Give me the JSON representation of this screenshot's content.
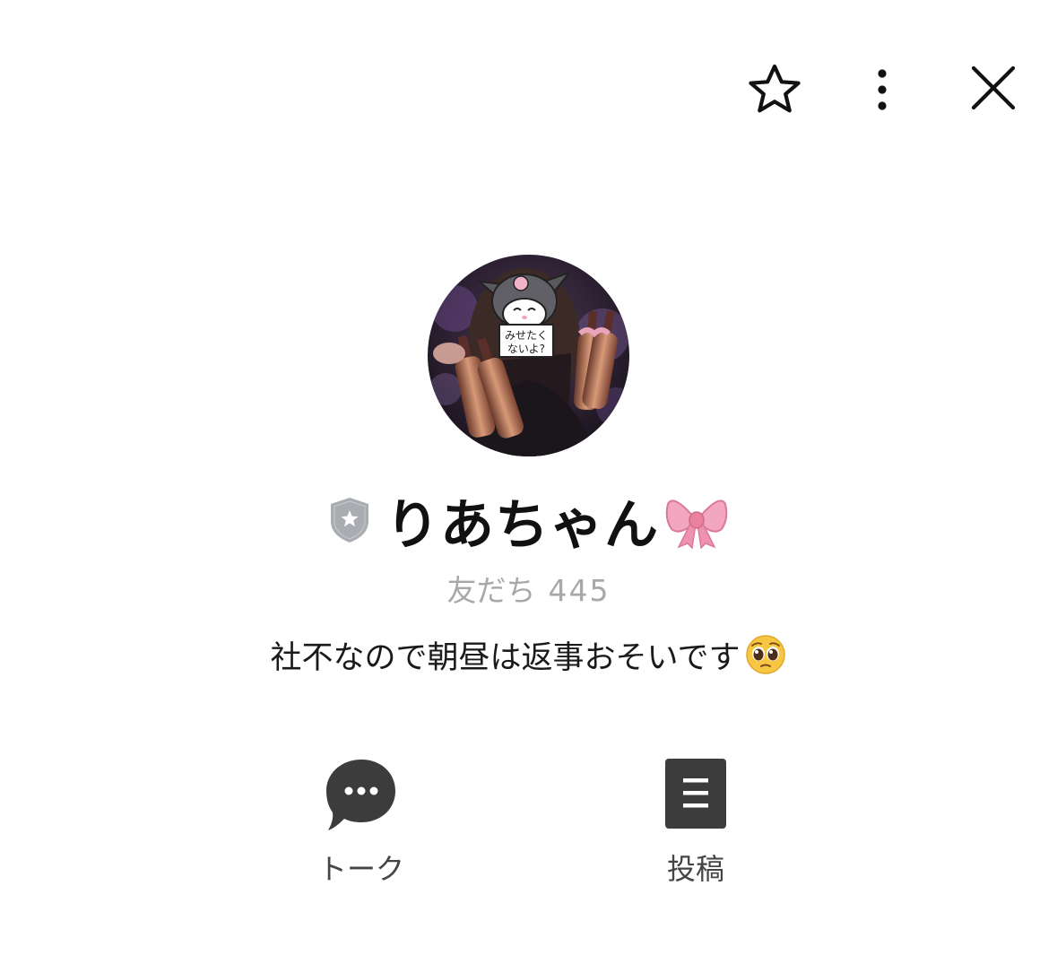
{
  "header": {
    "favorite_icon": "star-outline-icon",
    "more_icon": "vertical-ellipsis-icon",
    "close_icon": "close-x-icon"
  },
  "profile": {
    "avatar_text_line1": "みせたく",
    "avatar_text_line2": "ないよ?",
    "badge_icon": "shield-star-icon",
    "name": "りあちゃん",
    "name_emoji": "ribbon-emoji",
    "friends_label": "友だち",
    "friends_count": "445",
    "status_message": "社不なので朝昼は返事おそいです",
    "status_emoji": "pleading-face-emoji"
  },
  "actions": [
    {
      "label": "トーク",
      "icon": "chat-bubble-icon"
    },
    {
      "label": "投稿",
      "icon": "post-list-icon"
    }
  ],
  "colors": {
    "background": "#ffffff",
    "text_primary": "#111111",
    "text_muted": "#a8a8a8",
    "icon_dark": "#3c3c3c",
    "badge_gray": "#a9acb0"
  }
}
